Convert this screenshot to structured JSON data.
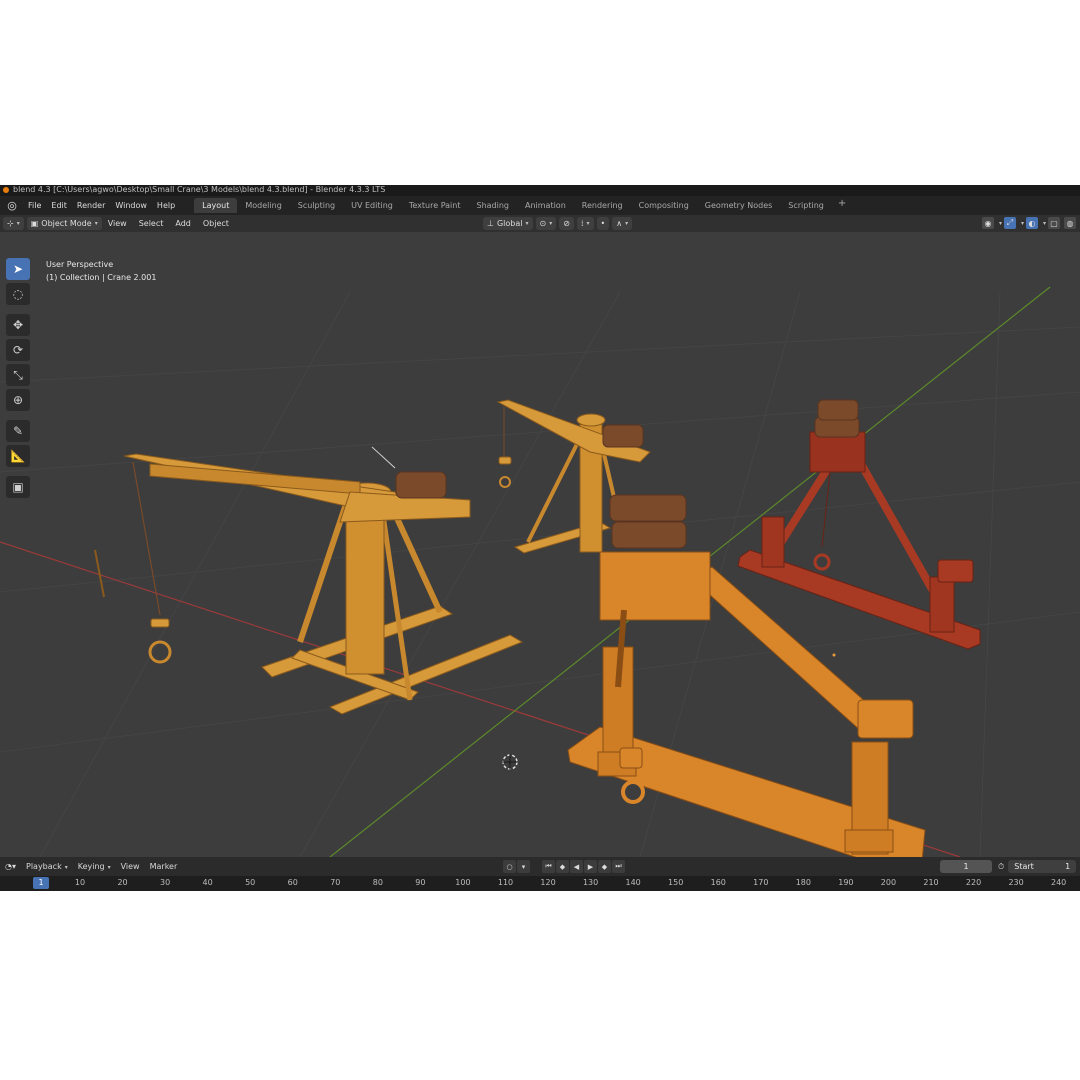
{
  "window": {
    "title": "blend 4.3 [C:\\Users\\agwo\\Desktop\\Small Crane\\3 Models\\blend 4.3.blend] - Blender 4.3.3 LTS"
  },
  "menubar": {
    "menus": [
      "File",
      "Edit",
      "Render",
      "Window",
      "Help"
    ],
    "workspace_tabs": [
      "Layout",
      "Modeling",
      "Sculpting",
      "UV Editing",
      "Texture Paint",
      "Shading",
      "Animation",
      "Rendering",
      "Compositing",
      "Geometry Nodes",
      "Scripting"
    ],
    "active_tab": "Layout",
    "add_tab": "+"
  },
  "header": {
    "mode": "Object Mode",
    "menus": [
      "View",
      "Select",
      "Add",
      "Object"
    ],
    "transform_orientation": "Global"
  },
  "viewport": {
    "view_name": "User Perspective",
    "collection_info": "(1) Collection | Crane 2.001",
    "colors": {
      "background": "#3d3d3d",
      "x_axis": "#9b3a3a",
      "y_axis": "#5d8a2a",
      "crane_yellow": "#d79a3a",
      "crane_orange": "#d9862b",
      "crane_red": "#a83a24",
      "cable_copper": "#8a4a2a"
    },
    "objects": [
      "crane-large-yellow",
      "crane-small-yellow",
      "crane-orange-front",
      "crane-red-back"
    ]
  },
  "toolbar": {
    "tools": [
      "select-box",
      "cursor",
      "move",
      "rotate",
      "scale",
      "transform",
      "annotate",
      "measure",
      "add-cube"
    ],
    "active_tool": "select-box"
  },
  "timeline": {
    "menus": [
      "Playback",
      "Keying",
      "View",
      "Marker"
    ],
    "current_frame": "1",
    "start_label": "Start",
    "start_value": "1",
    "ruler_ticks": [
      "1",
      "10",
      "20",
      "30",
      "40",
      "50",
      "60",
      "70",
      "80",
      "90",
      "100",
      "110",
      "120",
      "130",
      "140",
      "150",
      "160",
      "170",
      "180",
      "190",
      "200",
      "210",
      "220",
      "230",
      "240"
    ]
  }
}
